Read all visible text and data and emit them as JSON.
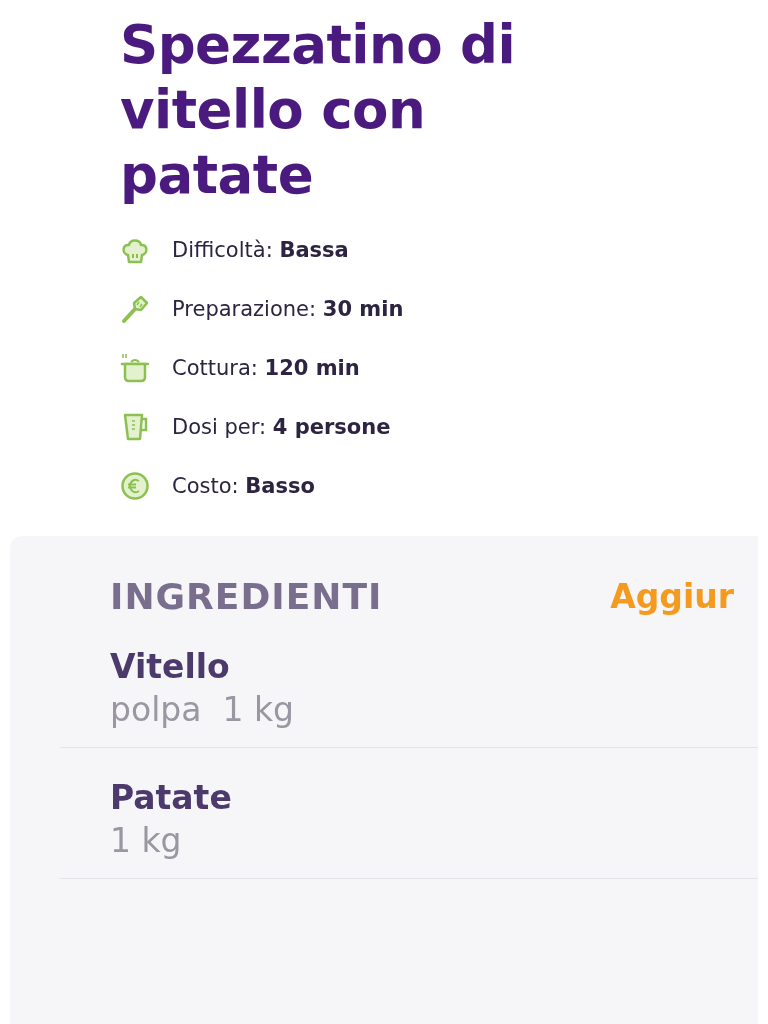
{
  "title": "Spezzatino di vitello con patate",
  "info": [
    {
      "kind": "difficulty",
      "label": "Difficoltà:",
      "value": "Bassa"
    },
    {
      "kind": "preparation",
      "label": "Preparazione:",
      "value": "30 min"
    },
    {
      "kind": "cooking",
      "label": "Cottura:",
      "value": "120 min"
    },
    {
      "kind": "servings",
      "label": "Dosi per:",
      "value": "4 persone"
    },
    {
      "kind": "cost",
      "label": "Costo:",
      "value": "Basso"
    }
  ],
  "ingredients": {
    "heading": "INGREDIENTI",
    "action": "Aggiur",
    "items": [
      {
        "name": "Vitello",
        "quantity": "polpa  1 kg"
      },
      {
        "name": "Patate",
        "quantity": "1 kg"
      }
    ]
  }
}
